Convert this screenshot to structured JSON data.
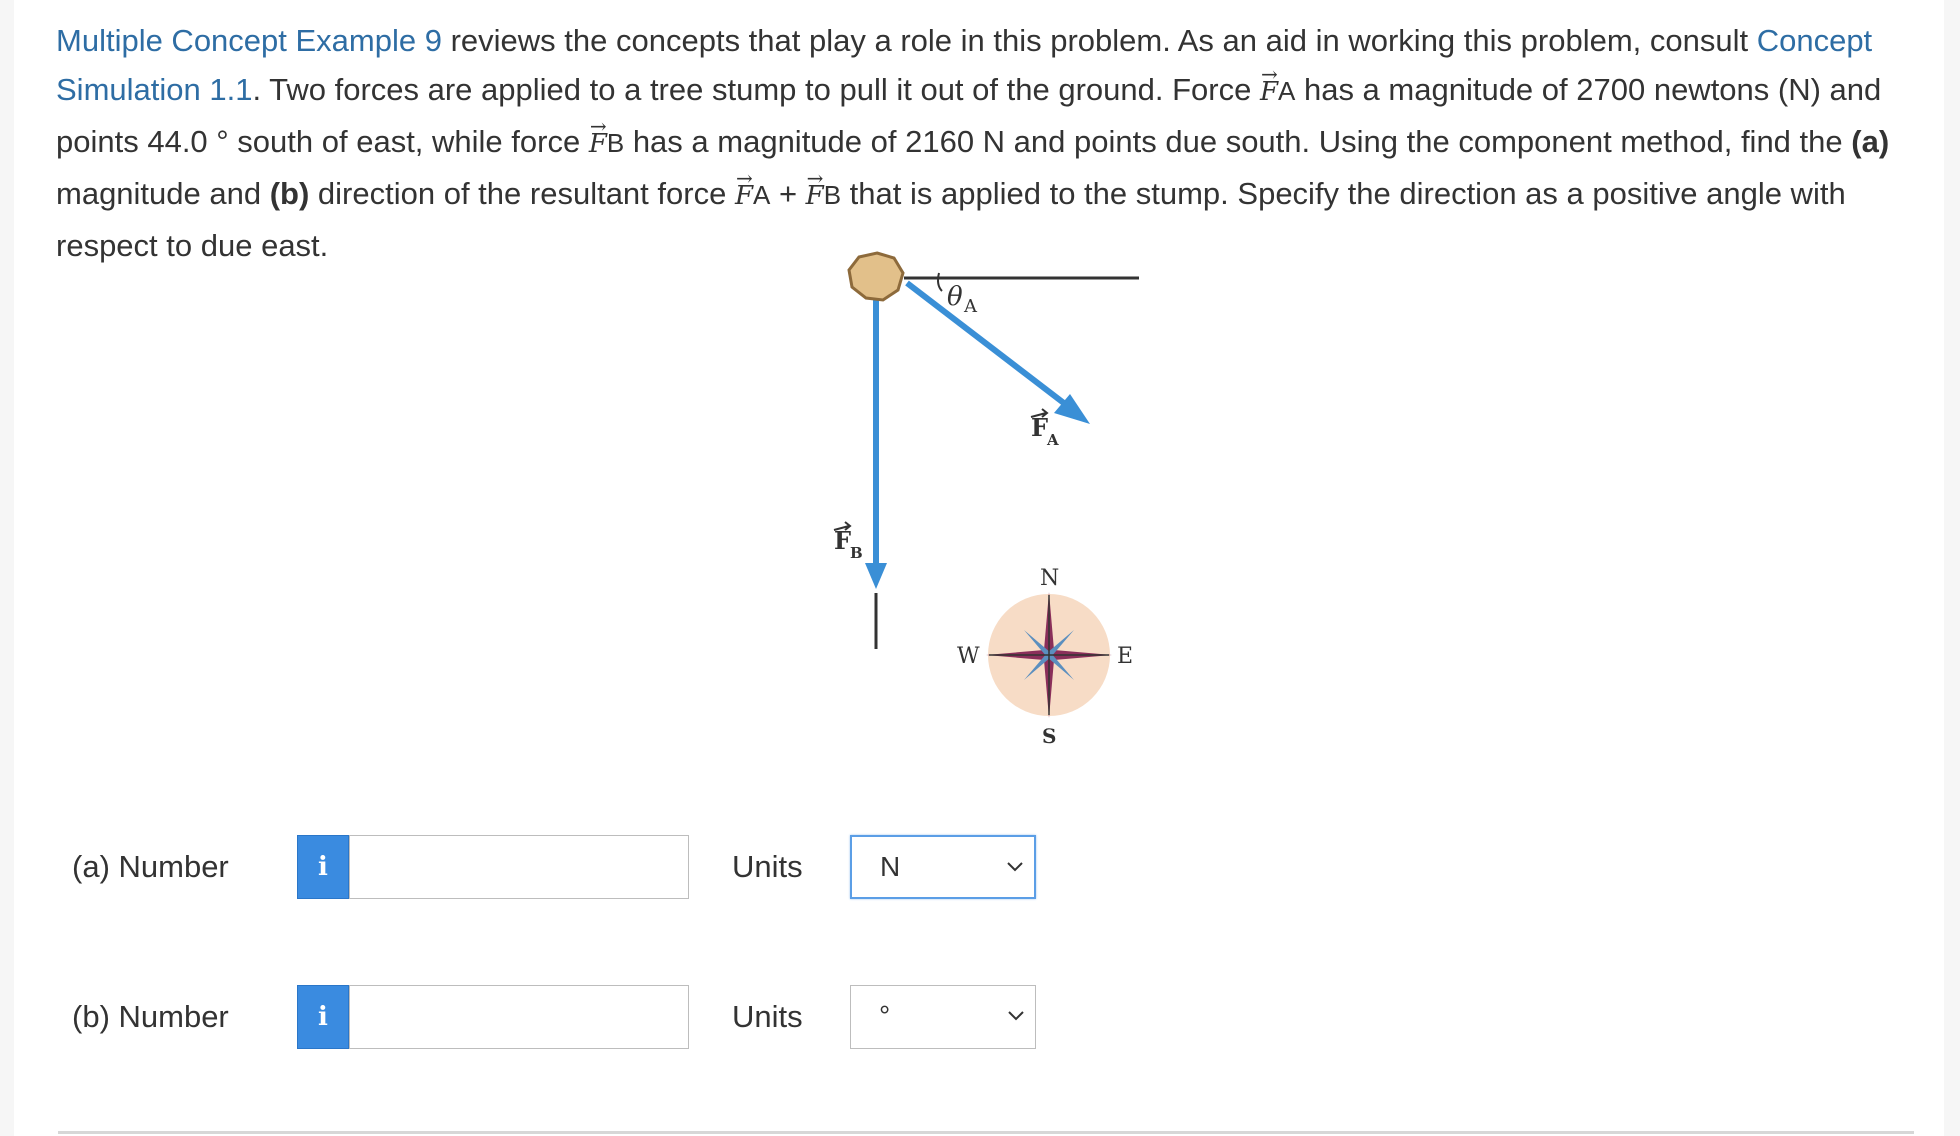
{
  "problem": {
    "link1": "Multiple Concept Example 9",
    "t1": " reviews the concepts that play a role in this problem. As an aid in working this problem, consult ",
    "link2": "Concept Simulation 1.1",
    "t2": ". Two forces are applied to a tree stump to pull it out of the ground. Force ",
    "vecA": "F",
    "subA": "A",
    "t3": " has a magnitude of 2700 newtons (N) and points 44.0 ° south of east, while force ",
    "vecB": "F",
    "subB": "B",
    "t4": " has a magnitude of 2160 N and points due south. Using the component method, find the ",
    "partA": "(a)",
    "t5": " magnitude and ",
    "partB": "(b)",
    "t6": " direction of the resultant force ",
    "plus": " + ",
    "t7": " that is applied to the stump. Specify the direction as a positive angle with respect to due east."
  },
  "figure": {
    "theta": "θ",
    "theta_sub": "A",
    "label_FA": "F",
    "label_FA_sub": "A",
    "label_FB": "F",
    "label_FB_sub": "B",
    "compass": {
      "N": "N",
      "S": "S",
      "E": "E",
      "W": "W"
    },
    "colors": {
      "arrow": "#3a8fd6",
      "stump": "#e2c08a",
      "compass_bg": "#f7dcc6",
      "compass_star": "#8a2f5a"
    }
  },
  "answers": [
    {
      "label": "(a)   Number",
      "info": "i",
      "value": "",
      "units_label": "Units",
      "unit_selected": "N"
    },
    {
      "label": "(b)   Number",
      "info": "i",
      "value": "",
      "units_label": "Units",
      "unit_selected": "°"
    }
  ]
}
